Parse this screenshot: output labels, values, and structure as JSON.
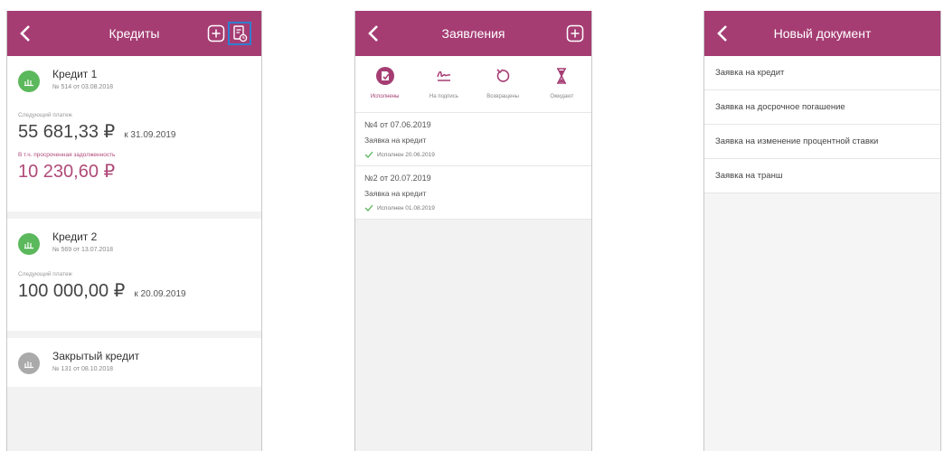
{
  "credits_screen": {
    "title": "Кредиты",
    "loans": [
      {
        "name": "Кредит 1",
        "number": "№ 514 от 03.08.2018",
        "icon_color": "#5cb85c",
        "next_payment_label": "Следующий платеж",
        "next_payment_amount": "55 681,33 ₽",
        "next_payment_date": "к 31.09.2019",
        "overdue_label": "В т.ч. просроченная задолженность",
        "overdue_amount": "10 230,60 ₽"
      },
      {
        "name": "Кредит 2",
        "number": "№ 569 от 13.07.2018",
        "icon_color": "#5cb85c",
        "next_payment_label": "Следующий платеж",
        "next_payment_amount": "100 000,00 ₽",
        "next_payment_date": "к 20.09.2019"
      },
      {
        "name": "Закрытый кредит",
        "number": "№ 131 от 08.10.2018",
        "icon_color": "#aaaaaa"
      }
    ]
  },
  "applications_screen": {
    "title": "Заявления",
    "tabs": [
      {
        "label": "Исполнены",
        "icon": "completed-icon",
        "active": true
      },
      {
        "label": "На подпись",
        "icon": "signature-icon",
        "active": false
      },
      {
        "label": "Возвращены",
        "icon": "return-icon",
        "active": false
      },
      {
        "label": "Ожидают",
        "icon": "hourglass-icon",
        "active": false
      }
    ],
    "items": [
      {
        "title": "№4 от 07.06.2019",
        "type": "Заявка на кредит",
        "status": "Исполнен 20.06.2019"
      },
      {
        "title": "№2 от 20.07.2019",
        "type": "Заявка на кредит",
        "status": "Исполнен 01.08.2019"
      }
    ]
  },
  "new_document_screen": {
    "title": "Новый документ",
    "items": [
      "Заявка на кредит",
      "Заявка на досрочное погашение",
      "Заявка на изменение процентной ставки",
      "Заявка на транш"
    ]
  },
  "colors": {
    "header": "#a53d73",
    "overdue": "#b04a78",
    "check": "#5cb85c",
    "highlight": "#2f7fd1"
  }
}
